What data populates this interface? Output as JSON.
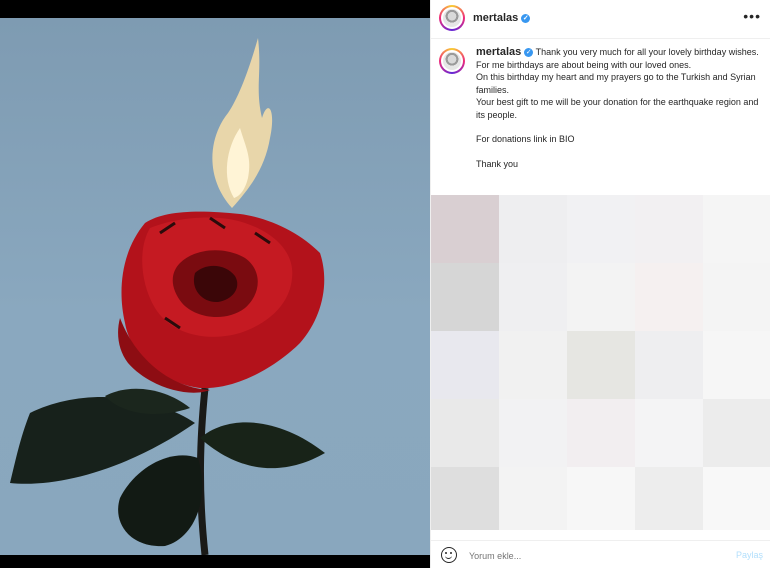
{
  "post": {
    "username": "mertalas",
    "more_label": "•••",
    "caption_lines": [
      "Thank you very much for all your lovely birthday wishes.",
      "For me birthdays are about being with our loved ones.",
      "On this birthday my heart and my prayers go to the Turkish and Syrian families.",
      "Your best gift to me will be your donation for the earthquake region and its people.",
      "",
      "For donations link in BIO",
      "",
      "Thank you"
    ],
    "media_description_icon": "burning-red-rose"
  },
  "footer": {
    "comment_placeholder": "Yorum ekle...",
    "share_label": "Paylaş"
  },
  "colors": {
    "verified": "#3897f0",
    "share_inactive": "#b2dffc",
    "photo_background": "#84a2b9",
    "rose": "#b3121b"
  },
  "blurred_tiles": [
    "#d9cfd2",
    "#eeeef0",
    "#f1f1f3",
    "#f2f0f2",
    "#f5f5f5",
    "#d6d6d6",
    "#efeff1",
    "#f3f3f3",
    "#f5f0f0",
    "#f4f4f4",
    "#e8e8ee",
    "#f1f1f1",
    "#e6e6e2",
    "#eeeef0",
    "#f6f6f6",
    "#e9e9e9",
    "#f2f2f3",
    "#f2eef0",
    "#f4f4f5",
    "#ececec",
    "#dedede",
    "#f3f3f3",
    "#f7f7f7",
    "#ededed",
    "#f8f8f8"
  ]
}
